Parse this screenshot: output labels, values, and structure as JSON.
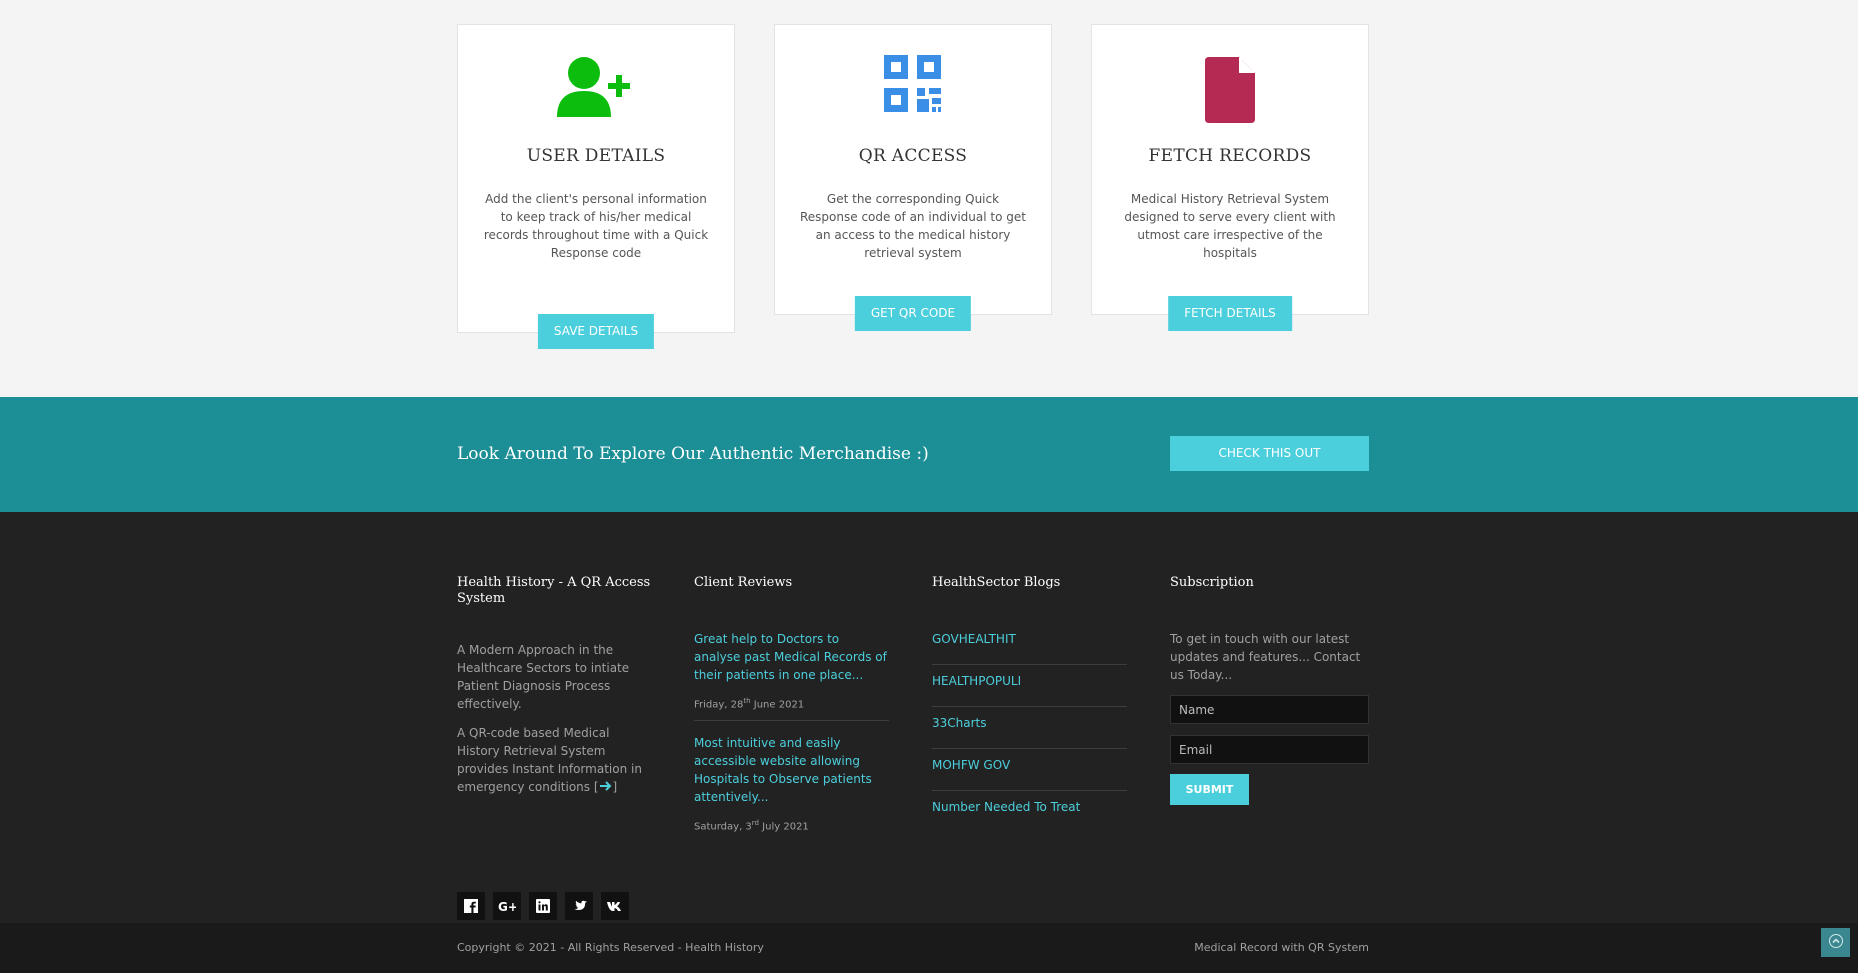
{
  "features": {
    "cards": [
      {
        "icon": "user-plus-icon",
        "title": "USER DETAILS",
        "description": "Add the client's personal information to keep track of his/her medical records throughout time with a Quick Response code",
        "button": "SAVE DETAILS"
      },
      {
        "icon": "qr-code-icon",
        "title": "QR ACCESS",
        "description": "Get the corresponding Quick Response code of an individual to get an access to the medical history retrieval system",
        "button": "GET QR CODE"
      },
      {
        "icon": "document-icon",
        "title": "FETCH RECORDS",
        "description": "Medical History Retrieval System designed to serve every client with utmost care irrespective of the hospitals",
        "button": "FETCH DETAILS"
      }
    ]
  },
  "cta": {
    "text": "Look Around To Explore Our Authentic Merchandise :)",
    "button": "CHECK THIS OUT"
  },
  "footer": {
    "about": {
      "title": "Health History - A QR Access System",
      "para1": "A Modern Approach in the Healthcare Sectors to intiate Patient Diagnosis Process effectively.",
      "para2": "A QR-code based Medical History Retrieval System provides Instant Information in emergency conditions [",
      "para2_end": "]",
      "socials": [
        "facebook-icon",
        "google-plus-icon",
        "linkedin-icon",
        "twitter-icon",
        "vk-icon"
      ]
    },
    "reviews": {
      "title": "Client Reviews",
      "items": [
        {
          "text": "Great help to Doctors to analyse past Medical Records of their patients in one place...",
          "date_pre": "Friday, 28",
          "date_sup": "th",
          "date_post": " June 2021"
        },
        {
          "text": "Most intuitive and easily accessible website allowing Hospitals to Observe patients attentively...",
          "date_pre": "Saturday, 3",
          "date_sup": "rd",
          "date_post": " July 2021"
        }
      ]
    },
    "blogs": {
      "title": "HealthSector Blogs",
      "links": [
        "GOVHEALTHIT",
        "HEALTHPOPULI",
        "33Charts",
        "MOHFW GOV",
        "Number Needed To Treat"
      ]
    },
    "subscription": {
      "title": "Subscription",
      "text": "To get in touch with our latest updates and features... Contact us Today...",
      "name_placeholder": "Name",
      "email_placeholder": "Email",
      "submit": "SUBMIT"
    }
  },
  "bottom": {
    "copyright": "Copyright © 2021 - All Rights Reserved - Health History",
    "tagline": "Medical Record with QR System"
  },
  "colors": {
    "accent": "#4ccfdc",
    "band": "#1b8e96",
    "user_icon": "#0dbd0d",
    "qr_icon": "#3a8ee6",
    "doc_icon": "#b52a52"
  }
}
